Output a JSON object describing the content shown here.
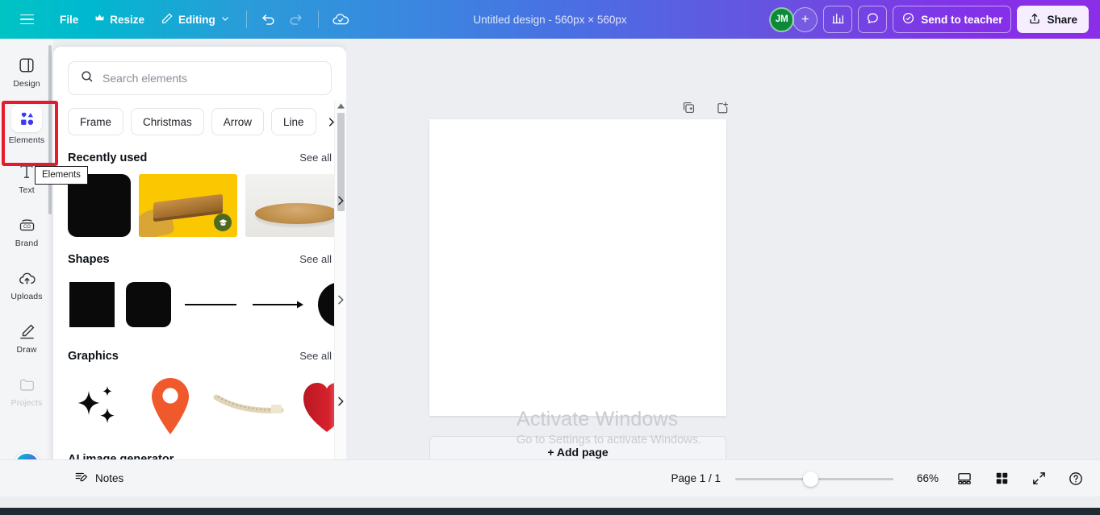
{
  "header": {
    "menu_icon": "hamburger-icon",
    "file_label": "File",
    "resize_label": "Resize",
    "resize_icon": "crown-icon",
    "editing_label": "Editing",
    "editing_icon": "pencil-icon",
    "chevron_icon": "chevron-down-icon",
    "undo_icon": "undo-icon",
    "redo_icon": "redo-icon",
    "cloud_icon": "cloud-saved-icon",
    "doc_title": "Untitled design - 560px × 560px",
    "avatar_initials": "JM",
    "add_collaborator_icon": "plus-icon",
    "insights_icon": "bar-chart-icon",
    "comment_icon": "comment-icon",
    "send_to_teacher_label": "Send to teacher",
    "send_to_teacher_icon": "check-circle-icon",
    "share_label": "Share",
    "share_icon": "upload-icon"
  },
  "rail": {
    "items": [
      {
        "label": "Design",
        "icon": "design-icon",
        "active": false,
        "dim": false
      },
      {
        "label": "Elements",
        "icon": "elements-icon",
        "active": true,
        "dim": false
      },
      {
        "label": "Text",
        "icon": "text-icon",
        "active": false,
        "dim": false
      },
      {
        "label": "Brand",
        "icon": "brand-icon",
        "active": false,
        "dim": false
      },
      {
        "label": "Uploads",
        "icon": "uploads-icon",
        "active": false,
        "dim": false
      },
      {
        "label": "Draw",
        "icon": "draw-icon",
        "active": false,
        "dim": false
      },
      {
        "label": "Projects",
        "icon": "projects-icon",
        "active": false,
        "dim": true
      }
    ],
    "magic_icon": "magic-star-icon",
    "tooltip": "Elements"
  },
  "panel": {
    "search": {
      "placeholder": "Search elements",
      "value": "",
      "icon": "search-icon"
    },
    "chips": [
      "Frame",
      "Christmas",
      "Arrow",
      "Line"
    ],
    "chip_next_icon": "chevron-right-icon",
    "sections": [
      {
        "title": "Recently used",
        "see_all": "See all",
        "next_icon": "chevron-right-icon",
        "items": [
          "black-rounded-square",
          "yellow-wooden-board-photo",
          "wooden-plate-photo"
        ]
      },
      {
        "title": "Shapes",
        "see_all": "See all",
        "next_icon": "chevron-right-icon",
        "items": [
          "square-shape",
          "rounded-square-shape",
          "line-shape",
          "arrow-shape",
          "circle-shape"
        ]
      },
      {
        "title": "Graphics",
        "see_all": "See all",
        "next_icon": "chevron-right-icon",
        "items": [
          "sparkle-stars-graphic",
          "map-pin-graphic",
          "gold-chain-graphic",
          "red-heart-graphic"
        ]
      }
    ],
    "ai_section_title": "AI image generator",
    "scrollbar": {
      "up_icon": "caret-up-icon",
      "down_icon": "caret-down-icon"
    }
  },
  "canvas": {
    "duplicate_page_icon": "duplicate-page-icon",
    "add_page_icon": "add-page-icon",
    "add_page_label": "+ Add page"
  },
  "watermark": {
    "title": "Activate Windows",
    "subtitle": "Go to Settings to activate Windows."
  },
  "bottombar": {
    "notes_label": "Notes",
    "notes_icon": "notes-icon",
    "page_count": "Page 1 / 1",
    "zoom_value": "66%",
    "zoom_percent": 66,
    "presenter_icon": "presenter-view-icon",
    "grid_icon": "grid-view-icon",
    "fullscreen_icon": "fullscreen-icon",
    "help_icon": "help-icon"
  },
  "colors": {
    "brand_teal": "#00c4cc",
    "brand_purple": "#8b2ee8",
    "avatar_green": "#0b8a3a",
    "annotation_red": "#e8192c",
    "canvas_bg": "#edeef2",
    "panel_bg": "#ffffff"
  }
}
